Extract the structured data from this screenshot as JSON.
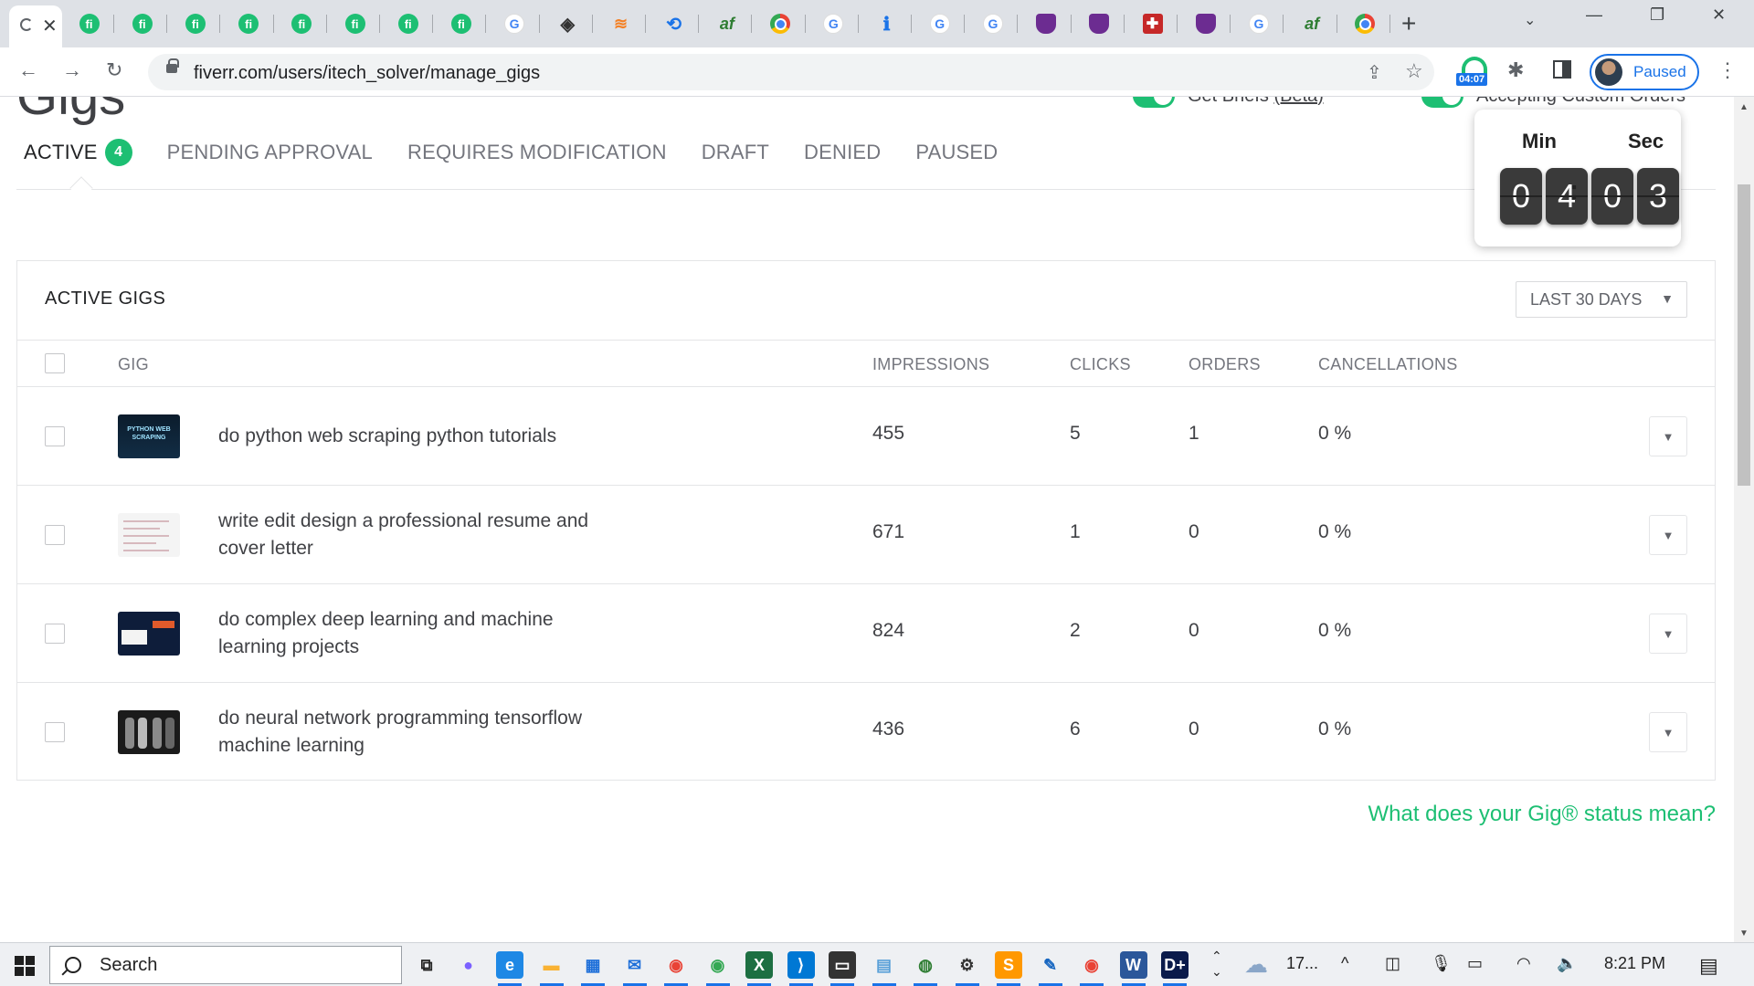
{
  "browser": {
    "url": "fiverr.com/users/itech_solver/manage_gigs",
    "profile_label": "Paused",
    "timer_badge": "04:07",
    "pinned_tabs": [
      {
        "icon": "fiverr-icon",
        "glyph": "fi",
        "kind": "fiverr"
      },
      {
        "icon": "fiverr-icon",
        "glyph": "fi",
        "kind": "fiverr"
      },
      {
        "icon": "fiverr-icon",
        "glyph": "fi",
        "kind": "fiverr"
      },
      {
        "icon": "fiverr-icon",
        "glyph": "fi",
        "kind": "fiverr"
      },
      {
        "icon": "fiverr-icon",
        "glyph": "fi",
        "kind": "fiverr"
      },
      {
        "icon": "fiverr-icon",
        "glyph": "fi",
        "kind": "fiverr"
      },
      {
        "icon": "fiverr-icon",
        "glyph": "fi",
        "kind": "fiverr"
      },
      {
        "icon": "fiverr-icon",
        "glyph": "fi",
        "kind": "fiverr"
      },
      {
        "icon": "google-icon",
        "glyph": "G",
        "kind": "google"
      },
      {
        "icon": "diamond-icon",
        "glyph": "◈",
        "kind": "diamond"
      },
      {
        "icon": "stackoverflow-icon",
        "glyph": "≋",
        "kind": "so"
      },
      {
        "icon": "history-icon",
        "glyph": "⟲",
        "kind": "hist"
      },
      {
        "icon": "af-icon",
        "glyph": "af",
        "kind": "af"
      },
      {
        "icon": "chrome-icon",
        "glyph": "",
        "kind": "chrome"
      },
      {
        "icon": "google-icon",
        "glyph": "G",
        "kind": "google"
      },
      {
        "icon": "info-icon",
        "glyph": "ℹ",
        "kind": "info"
      },
      {
        "icon": "google-icon",
        "glyph": "G",
        "kind": "google"
      },
      {
        "icon": "google-icon",
        "glyph": "G",
        "kind": "google"
      },
      {
        "icon": "brave-icon",
        "glyph": "",
        "kind": "brave"
      },
      {
        "icon": "brave-icon",
        "glyph": "",
        "kind": "brave"
      },
      {
        "icon": "cross-icon",
        "glyph": "✚",
        "kind": "cross"
      },
      {
        "icon": "brave-icon",
        "glyph": "",
        "kind": "brave"
      },
      {
        "icon": "google-icon",
        "glyph": "G",
        "kind": "google"
      },
      {
        "icon": "af-icon",
        "glyph": "af",
        "kind": "af"
      },
      {
        "icon": "chrome-icon",
        "glyph": "",
        "kind": "chrome"
      }
    ]
  },
  "page": {
    "title": "Gigs",
    "toggles": [
      {
        "label": "Get Briefs",
        "link": "(Beta)"
      },
      {
        "label": "Accepting Custom Orders",
        "link": ""
      }
    ],
    "tabs": [
      {
        "label": "ACTIVE",
        "count": "4"
      },
      {
        "label": "PENDING APPROVAL"
      },
      {
        "label": "REQUIRES MODIFICATION"
      },
      {
        "label": "DRAFT"
      },
      {
        "label": "DENIED"
      },
      {
        "label": "PAUSED"
      }
    ],
    "timer": {
      "min_label": "Min",
      "sec_label": "Sec",
      "digits": [
        "0",
        "4",
        "0",
        "3"
      ]
    },
    "panel": {
      "title": "ACTIVE GIGS",
      "period": "LAST 30 DAYS",
      "columns": {
        "gig": "GIG",
        "impressions": "IMPRESSIONS",
        "clicks": "CLICKS",
        "orders": "ORDERS",
        "cancellations": "CANCELLATIONS"
      },
      "rows": [
        {
          "title": "do python web scraping python tutorials",
          "impressions": "455",
          "clicks": "5",
          "orders": "1",
          "cancellations": "0 %",
          "thumb_text": "PYTHON WEB SCRAPING"
        },
        {
          "title": "write edit design a professional resume and cover letter",
          "impressions": "671",
          "clicks": "1",
          "orders": "0",
          "cancellations": "0 %"
        },
        {
          "title": "do complex deep learning and machine learning projects",
          "impressions": "824",
          "clicks": "2",
          "orders": "0",
          "cancellations": "0 %"
        },
        {
          "title": "do neural network programming tensorflow machine learning",
          "impressions": "436",
          "clicks": "6",
          "orders": "0",
          "cancellations": "0 %"
        }
      ]
    },
    "status_link": "What does your Gig® status mean?"
  },
  "taskbar": {
    "search_label": "Search",
    "weather": "17...",
    "time": "8:21 PM",
    "apps": [
      {
        "name": "task-view-icon",
        "glyph": "⧉",
        "color": "#222222",
        "bg": "transparent"
      },
      {
        "name": "copilot-icon",
        "glyph": "●",
        "color": "#7b61ff",
        "bg": "transparent"
      },
      {
        "name": "edge-icon",
        "glyph": "e",
        "color": "#ffffff",
        "bg": "#1e88e5"
      },
      {
        "name": "file-explorer-icon",
        "glyph": "▬",
        "color": "#f9b233",
        "bg": "transparent"
      },
      {
        "name": "store-icon",
        "glyph": "▦",
        "color": "#1e6fd9",
        "bg": "transparent"
      },
      {
        "name": "mail-icon",
        "glyph": "✉",
        "color": "#1e6fd9",
        "bg": "transparent"
      },
      {
        "name": "chrome-icon",
        "glyph": "◉",
        "color": "#e94235",
        "bg": "transparent"
      },
      {
        "name": "chrome-icon",
        "glyph": "◉",
        "color": "#34a853",
        "bg": "transparent"
      },
      {
        "name": "excel-icon",
        "glyph": "X",
        "color": "#ffffff",
        "bg": "#1d6f42"
      },
      {
        "name": "vscode-icon",
        "glyph": "⟩",
        "color": "#ffffff",
        "bg": "#0078d4"
      },
      {
        "name": "terminal-icon",
        "glyph": "▭",
        "color": "#ffffff",
        "bg": "#333333"
      },
      {
        "name": "notes-icon",
        "glyph": "▤",
        "color": "#5aa0d8",
        "bg": "transparent"
      },
      {
        "name": "globe-icon",
        "glyph": "◍",
        "color": "#2e7d32",
        "bg": "transparent"
      },
      {
        "name": "settings-icon",
        "glyph": "⚙",
        "color": "#333333",
        "bg": "transparent"
      },
      {
        "name": "sublime-icon",
        "glyph": "S",
        "color": "#ffffff",
        "bg": "#ff9800"
      },
      {
        "name": "paint-icon",
        "glyph": "✎",
        "color": "#1565c0",
        "bg": "transparent"
      },
      {
        "name": "chrome-icon",
        "glyph": "◉",
        "color": "#e94235",
        "bg": "transparent"
      },
      {
        "name": "word-icon",
        "glyph": "W",
        "color": "#ffffff",
        "bg": "#2b579a"
      },
      {
        "name": "disney-icon",
        "glyph": "D+",
        "color": "#ffffff",
        "bg": "#0b1b4b"
      }
    ]
  }
}
